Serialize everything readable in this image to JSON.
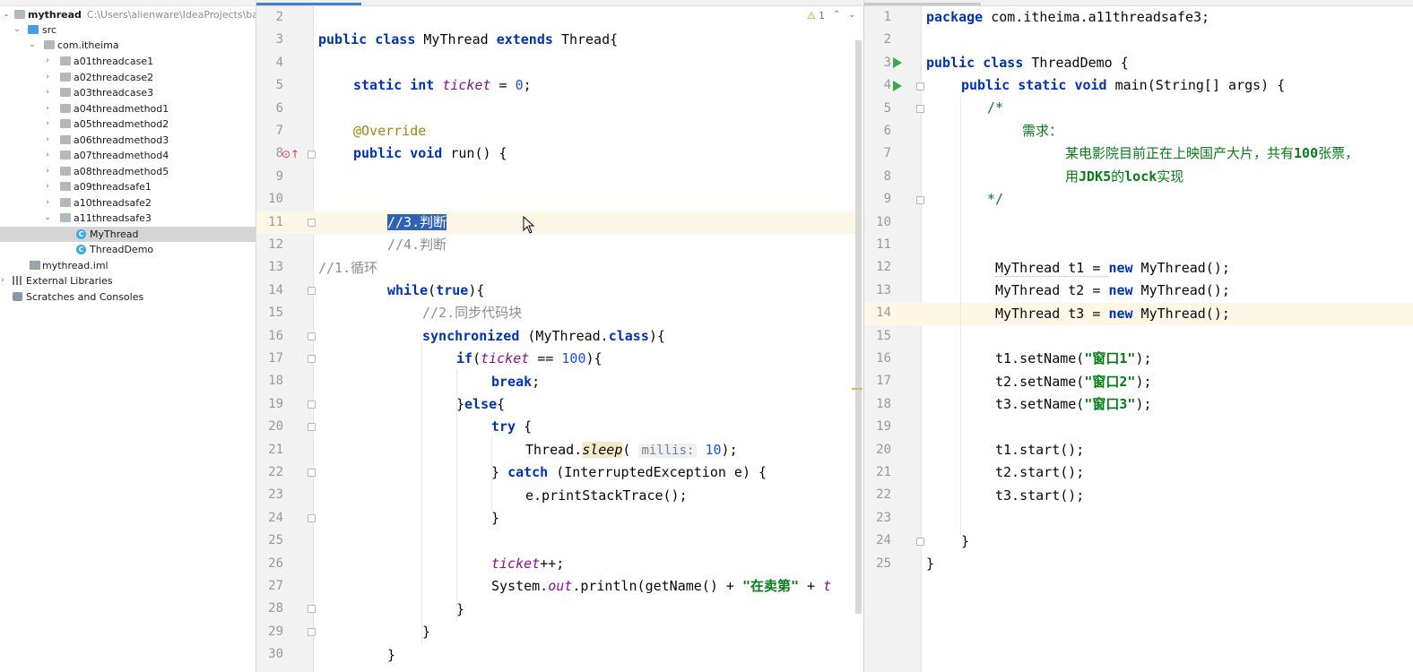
{
  "project_tree": {
    "root_name": "mythread",
    "root_path": "C:\\Users\\alienware\\IdeaProjects\\basic-",
    "src": "src",
    "package": "com.itheima",
    "packages": [
      "a01threadcase1",
      "a02threadcase2",
      "a03threadcase3",
      "a04threadmethod1",
      "a05threadmethod2",
      "a06threadmethod3",
      "a07threadmethod4",
      "a08threadmethod5",
      "a09threadsafe1",
      "a10threadsafe2",
      "a11threadsafe3"
    ],
    "classes": [
      "MyThread",
      "ThreadDemo"
    ],
    "iml": "mythread.iml",
    "external_libraries": "External Libraries",
    "scratches": "Scratches and Consoles"
  },
  "left_editor": {
    "file": "MyThread",
    "warning_count": "1",
    "line_numbers": [
      "2",
      "3",
      "4",
      "5",
      "6",
      "7",
      "8",
      "9",
      "10",
      "11",
      "12",
      "13",
      "14",
      "15",
      "16",
      "17",
      "18",
      "19",
      "20",
      "21",
      "22",
      "23",
      "24",
      "25",
      "26",
      "27",
      "28",
      "29",
      "30"
    ],
    "tokens": {
      "public": "public",
      "class": "class",
      "name": "MyThread",
      "extends": "extends",
      "thread_brace": "Thread{",
      "static": "static",
      "int": "int",
      "ticket": "ticket",
      "eq_zero": " = ",
      "zero": "0",
      "semi": ";",
      "override": "@Override",
      "void": "void",
      "run": " run() {",
      "c3": "//3.判断",
      "c4": "//4.判断",
      "c1": "//1.循环",
      "while": "while",
      "true": "true",
      "while_end": "){",
      "c2": "//2.同步代码块",
      "synchronized": "synchronized",
      "sync_rest": " (MyThread.",
      "sync_class": "class",
      "sync_end": "){",
      "if": "if",
      "if_open": "(",
      "if_eq": " == ",
      "hundred": "100",
      "if_end": "){",
      "break": "break",
      "else_open": "}",
      "else": "else",
      "else_brace": "{",
      "try": "try",
      "try_brace": " {",
      "thread_dot": "Thread.",
      "sleep": "sleep",
      "paren": "(",
      "millis": "millis:",
      "ten": "10",
      "sleep_end": ");",
      "catch_open": "} ",
      "catch": "catch",
      "catch_rest": " (InterruptedException e) {",
      "print_stack": "e.printStackTrace();",
      "close": "}",
      "inc": "++;",
      "sysout": "System.",
      "out": "out",
      "println": ".println(getName() + ",
      "sell_str": "\"在卖第\"",
      "plus": " + ",
      "t_cut": "t"
    }
  },
  "right_editor": {
    "file": "ThreadDemo",
    "line_numbers": [
      "1",
      "2",
      "3",
      "4",
      "5",
      "6",
      "7",
      "8",
      "9",
      "10",
      "11",
      "12",
      "13",
      "14",
      "15",
      "16",
      "17",
      "18",
      "19",
      "20",
      "21",
      "22",
      "23",
      "24",
      "25"
    ],
    "tokens": {
      "package": "package",
      "pkg_name": " com.itheima.a11threadsafe3;",
      "public": "public",
      "class": "class",
      "class_name": " ThreadDemo {",
      "static": "static",
      "void": "void",
      "main": " main(String[] args) {",
      "doc_open": "/*",
      "req": "需求：",
      "req1": "某电影院目前正在上映国产大片，共有",
      "req_num": "100",
      "req1b": "张票，",
      "req2": "用",
      "req2_jdk": "JDK5",
      "req2_b": "的",
      "req2_lock": "lock",
      "req2_c": "实现",
      "doc_close": "*/",
      "t1_decl": "MyThread t1 = ",
      "t2_decl": "MyThread t2 = ",
      "t3_decl": "MyThread t3 = ",
      "new": "new",
      "ctor": " MyThread();",
      "t1_set": "t1.setName(",
      "t2_set": "t2.setName(",
      "t3_set": "t3.setName(",
      "win1": "\"窗口1\"",
      "win2": "\"窗口2\"",
      "win3": "\"窗口3\"",
      "set_end": ");",
      "t1_start": "t1.start();",
      "t2_start": "t2.start();",
      "t3_start": "t3.start();",
      "brace": "}"
    }
  },
  "icons": [
    "folder-icon",
    "package-icon",
    "class-icon",
    "module-file-icon",
    "library-icon",
    "scratches-icon",
    "run-gutter-icon",
    "override-marker-icon",
    "warning-icon",
    "chevron-up-icon",
    "chevron-down-icon",
    "mouse-cursor-icon"
  ]
}
